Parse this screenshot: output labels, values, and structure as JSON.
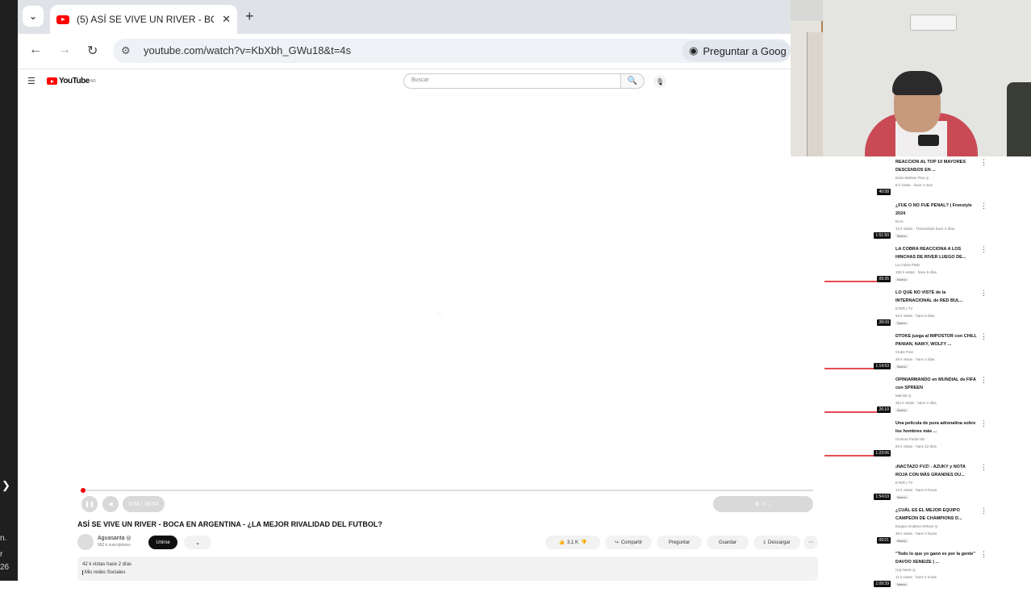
{
  "browser": {
    "tab_title": "(5) ASÍ SE VIVE UN RIVER - BOC",
    "close_glyph": "✕",
    "newtab_glyph": "+",
    "url": "youtube.com/watch?v=KbXbh_GWu18&t=4s",
    "ask_label": "Preguntar a Goog"
  },
  "youtube": {
    "logo_text": "YouTube",
    "region": "AR",
    "search_placeholder": "Buscar"
  },
  "player": {
    "time": "0:04 / 16:54"
  },
  "video": {
    "title": "ASÍ SE VIVE UN RIVER - BOCA EN ARGENTINA - ¿LA MEJOR RIVALIDAD DEL FUTBOL?",
    "channel_name": "Aguasanta ◎",
    "channel_subs": "962 k suscriptores",
    "join_label": "Unirse",
    "likes": "3,1 K",
    "share_label": "Compartir",
    "ask_label": "Preguntar",
    "save_label": "Guardar",
    "download_label": "Descargar",
    "desc_stats": "42 k vistas  hace 2 días",
    "desc_text": "Mis redes Sociales"
  },
  "left_strip": {
    "t1": "n.",
    "t2": "r",
    "t3": "26"
  },
  "recommendations": [
    {
      "title": "REACCION AL TOP 10 MAYORES DESCENSOS EN ...",
      "channel": "Dario Beltran Plus ◎",
      "meta": "8 k vistas · hace 1 mes",
      "duration": "40:58",
      "new": "",
      "progress": 0
    },
    {
      "title": "¿FUE O NO FUE PENAL? | Freestyle 2024",
      "channel": "ELIA",
      "meta": "43 k vistas · Transmitido hace 2 días",
      "duration": "1:51:50",
      "new": "Nuevo",
      "progress": 0
    },
    {
      "title": "LA COBRA REACCIONA A LOS HINCHAS DE RIVER LUEGO DE...",
      "channel": "La Cobra FWD",
      "meta": "155 k vistas · hace 5 días",
      "duration": "09:35",
      "new": "Nuevo",
      "progress": 0.95
    },
    {
      "title": "LO QUE NO VISTE de la INTERNACIONAL de RED BUL...",
      "channel": "ETER | TV",
      "meta": "54 k vistas · hace 5 días",
      "duration": "28:09",
      "new": "Nuevo",
      "progress": 0
    },
    {
      "title": "DTOKE juega al IMPOSTOR con CHILI, PANIAN, NAIKY, WOLFY ...",
      "channel": "Clubs Free",
      "meta": "36 k vistas · hace 2 días",
      "duration": "1:14:53",
      "new": "Nuevo",
      "progress": 0.95
    },
    {
      "title": "OPINIARMANDO en MUNDIAL de FIFA con SPREEN",
      "channel": "Marcial ◎",
      "meta": "311 k vistas · hace 4 días",
      "duration": "26:10",
      "new": "Nuevo",
      "progress": 0.95
    },
    {
      "title": "Una pelicula de pura adrenalina sobre los hombres más ...",
      "channel": "Cinema Portal HD",
      "meta": "83 k vistas · hace 12 días",
      "duration": "1:23:06",
      "new": "",
      "progress": 0.95
    },
    {
      "title": "¡NACTAZO FVZ! - AZUKY y NOTA ROJA CON MÁS GRANDES DU...",
      "channel": "ETER | TV",
      "meta": "14 k vistas · hace 6 horas",
      "duration": "1:54:03",
      "new": "Nuevo",
      "progress": 0
    },
    {
      "title": "¿CUÁL ES EL MEJOR EQUIPO CAMPEON DE CHAMPIONS D...",
      "channel": "Equipo Amateur Deluxe ◎",
      "meta": "35 k vistas · hace 3 horas",
      "duration": "09:01",
      "new": "Nuevo",
      "progress": 0
    },
    {
      "title": "\"Todo lo que yo ganó es por la gente\" DAVOO XENEIZE | ...",
      "channel": "Urg News ◎",
      "meta": "11 k vistas · hace 4 horas",
      "duration": "1:09:39",
      "new": "Nuevo",
      "progress": 0
    }
  ]
}
